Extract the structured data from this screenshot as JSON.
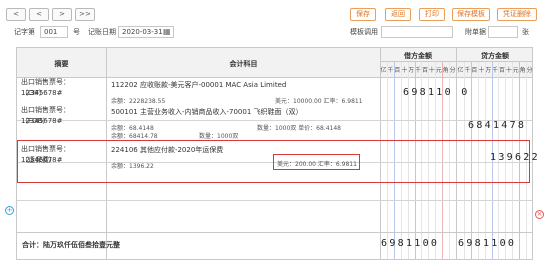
{
  "nav": {
    "first": "<",
    "prev": "<",
    "next": ">",
    "last": ">>"
  },
  "actions": {
    "save": "保存",
    "back": "返回",
    "print": "打印",
    "save_template": "保存模板",
    "delete_voucher": "凭证删除"
  },
  "voucher": {
    "type_label": "记字第",
    "number": "001",
    "number_suffix": "号",
    "date_label": "记账日期",
    "date": "2020-03-31",
    "template_label": "模板调用",
    "attach_label": "附单据",
    "attach_unit": "张"
  },
  "table": {
    "headers": {
      "summary": "摘要",
      "account": "会计科目",
      "debit": "借方金额",
      "credit": "贷方金额"
    },
    "units": [
      "亿",
      "千",
      "百",
      "十",
      "万",
      "千",
      "百",
      "十",
      "元",
      "角",
      "分"
    ],
    "rows": [
      {
        "summary_line1": "出口销售票号：12345678#",
        "summary_line2": "（CIF）",
        "account": "112202 应收账款-美元客户-00001 MAC Asia Limited",
        "balance": "余额：2228238.55",
        "fx": "美元：10000.00 汇率：6.9811",
        "debit": "698110 0",
        "credit": ""
      },
      {
        "summary_line1": "出口销售票号：12345678#",
        "summary_line2": "（FOB）",
        "account": "500101 主营业务收入-内销商品收入-70001 飞织鞋面（双）",
        "balance1": "余额：68.4148",
        "balance2": "余额：68414.78",
        "qty": "数量：1000双 单价：68.4148",
        "qty2": "数量：1000双",
        "debit": "",
        "credit": "6841478"
      },
      {
        "summary_line1": "出口销售票号：12345678#",
        "summary_line2": "（运保费）",
        "account": "224106 其他应付款-2020年运保费",
        "balance": "余额：1396.22",
        "fx": "美元：200.00 汇率：6.9811",
        "debit": "",
        "credit": "139622"
      }
    ],
    "total_label": "合计：陆万玖仟伍佰叁拾壹元整",
    "total_debit": "6981100",
    "total_credit": "6981100"
  },
  "icons": {
    "add": "+",
    "remove": "×",
    "calendar": "▦"
  }
}
